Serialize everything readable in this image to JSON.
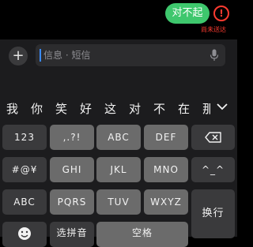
{
  "chat": {
    "message_text": "对不起",
    "error_mark": "!",
    "error_label": "尚未送达"
  },
  "compose": {
    "plus_glyph": "+",
    "placeholder": "信息 · 短信"
  },
  "keyboard": {
    "candidates": [
      "我",
      "你",
      "笑",
      "好",
      "这",
      "对",
      "不",
      "在",
      "那"
    ],
    "rows": [
      {
        "left": "123",
        "keys": [
          ",.?!",
          "ABC",
          "DEF"
        ],
        "right_icon": "backspace-icon"
      },
      {
        "left": "#@¥",
        "keys": [
          "GHI",
          "JKL",
          "MNO"
        ],
        "right": "^_^"
      },
      {
        "left": "ABC",
        "keys": [
          "PQRS",
          "TUV",
          "WXYZ"
        ],
        "right": "换行"
      }
    ],
    "bottom": {
      "pinyin": "选拼音",
      "space": "空格"
    }
  }
}
